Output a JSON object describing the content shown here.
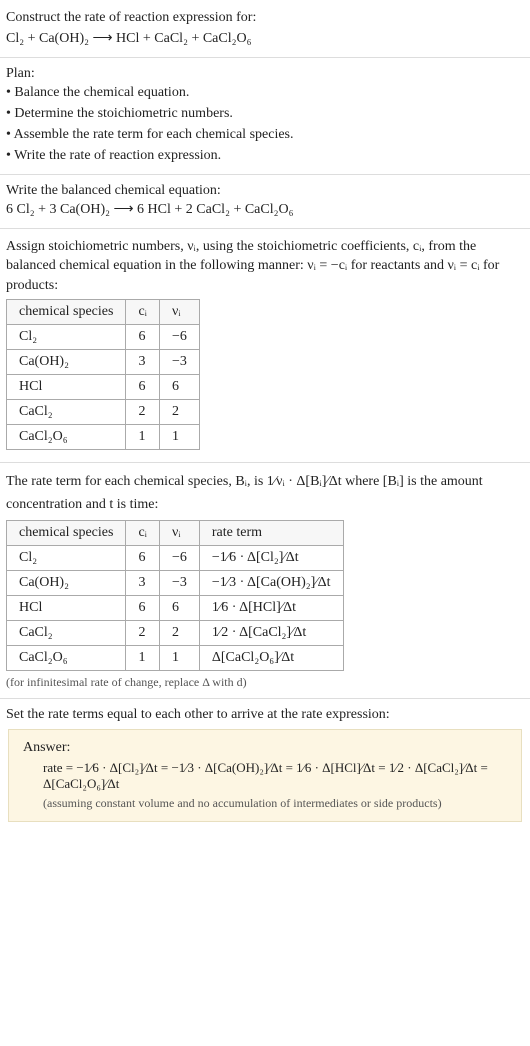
{
  "prompt": {
    "line1": "Construct the rate of reaction expression for:",
    "equation": "Cl₂ + Ca(OH)₂ ⟶ HCl + CaCl₂ + CaCl₂O₆"
  },
  "plan": {
    "title": "Plan:",
    "items": [
      "• Balance the chemical equation.",
      "• Determine the stoichiometric numbers.",
      "• Assemble the rate term for each chemical species.",
      "• Write the rate of reaction expression."
    ]
  },
  "balanced": {
    "line1": "Write the balanced chemical equation:",
    "equation": "6 Cl₂ + 3 Ca(OH)₂ ⟶ 6 HCl + 2 CaCl₂ + CaCl₂O₆"
  },
  "stoich_intro": "Assign stoichiometric numbers, νᵢ, using the stoichiometric coefficients, cᵢ, from the balanced chemical equation in the following manner: νᵢ = −cᵢ for reactants and νᵢ = cᵢ for products:",
  "table1": {
    "headers": [
      "chemical species",
      "cᵢ",
      "νᵢ"
    ],
    "rows": [
      [
        "Cl₂",
        "6",
        "−6"
      ],
      [
        "Ca(OH)₂",
        "3",
        "−3"
      ],
      [
        "HCl",
        "6",
        "6"
      ],
      [
        "CaCl₂",
        "2",
        "2"
      ],
      [
        "CaCl₂O₆",
        "1",
        "1"
      ]
    ]
  },
  "rate_intro_1": "The rate term for each chemical species, Bᵢ, is ",
  "rate_intro_frac": "1⁄νᵢ · Δ[Bᵢ]⁄Δt",
  "rate_intro_2": " where [Bᵢ] is the amount concentration and t is time:",
  "table2": {
    "headers": [
      "chemical species",
      "cᵢ",
      "νᵢ",
      "rate term"
    ],
    "rows": [
      [
        "Cl₂",
        "6",
        "−6",
        "−1⁄6 · Δ[Cl₂]⁄Δt"
      ],
      [
        "Ca(OH)₂",
        "3",
        "−3",
        "−1⁄3 · Δ[Ca(OH)₂]⁄Δt"
      ],
      [
        "HCl",
        "6",
        "6",
        "1⁄6 · Δ[HCl]⁄Δt"
      ],
      [
        "CaCl₂",
        "2",
        "2",
        "1⁄2 · Δ[CaCl₂]⁄Δt"
      ],
      [
        "CaCl₂O₆",
        "1",
        "1",
        "Δ[CaCl₂O₆]⁄Δt"
      ]
    ]
  },
  "table2_note": "(for infinitesimal rate of change, replace Δ with d)",
  "final_intro": "Set the rate terms equal to each other to arrive at the rate expression:",
  "answer": {
    "label": "Answer:",
    "equation": "rate = −1⁄6 · Δ[Cl₂]⁄Δt = −1⁄3 · Δ[Ca(OH)₂]⁄Δt = 1⁄6 · Δ[HCl]⁄Δt = 1⁄2 · Δ[CaCl₂]⁄Δt = Δ[CaCl₂O₆]⁄Δt",
    "note": "(assuming constant volume and no accumulation of intermediates or side products)"
  },
  "chart_data": {
    "type": "table",
    "tables": [
      {
        "title": "Stoichiometric numbers",
        "columns": [
          "chemical species",
          "c_i",
          "nu_i"
        ],
        "rows": [
          {
            "chemical species": "Cl2",
            "c_i": 6,
            "nu_i": -6
          },
          {
            "chemical species": "Ca(OH)2",
            "c_i": 3,
            "nu_i": -3
          },
          {
            "chemical species": "HCl",
            "c_i": 6,
            "nu_i": 6
          },
          {
            "chemical species": "CaCl2",
            "c_i": 2,
            "nu_i": 2
          },
          {
            "chemical species": "CaCl2O6",
            "c_i": 1,
            "nu_i": 1
          }
        ]
      },
      {
        "title": "Rate terms",
        "columns": [
          "chemical species",
          "c_i",
          "nu_i",
          "rate term"
        ],
        "rows": [
          {
            "chemical species": "Cl2",
            "c_i": 6,
            "nu_i": -6,
            "rate term": "-(1/6) d[Cl2]/dt"
          },
          {
            "chemical species": "Ca(OH)2",
            "c_i": 3,
            "nu_i": -3,
            "rate term": "-(1/3) d[Ca(OH)2]/dt"
          },
          {
            "chemical species": "HCl",
            "c_i": 6,
            "nu_i": 6,
            "rate term": "(1/6) d[HCl]/dt"
          },
          {
            "chemical species": "CaCl2",
            "c_i": 2,
            "nu_i": 2,
            "rate term": "(1/2) d[CaCl2]/dt"
          },
          {
            "chemical species": "CaCl2O6",
            "c_i": 1,
            "nu_i": 1,
            "rate term": "d[CaCl2O6]/dt"
          }
        ]
      }
    ]
  }
}
